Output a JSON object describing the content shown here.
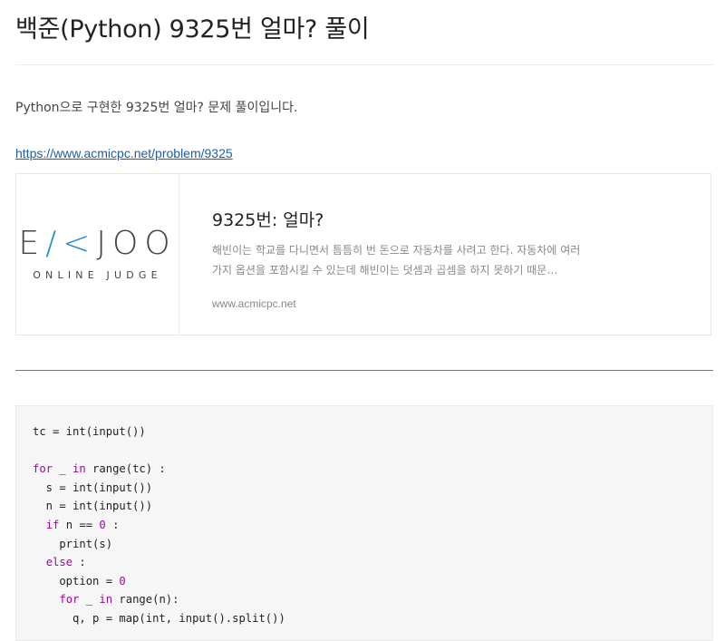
{
  "post": {
    "title": "백준(Python) 9325번 얼마? 풀이",
    "intro": "Python으로 구현한 9325번 얼마? 문제 풀이입니다.",
    "link": "https://www.acmicpc.net/problem/9325"
  },
  "link_card": {
    "logo_main_left": "E",
    "logo_main_accent": "/<",
    "logo_main_right": "JOO",
    "logo_sub": "ONLINE JUDGE",
    "title": "9325번: 얼마?",
    "description": "해빈이는 학교를 다니면서 틈틈히 번 돈으로 자동차를 사려고 한다. 자동차에 여러 가지 옵션을 포함시킬 수 있는데 해빈이는 덧셈과 곱셈을 하지 못하기 때문…",
    "host": "www.acmicpc.net"
  },
  "code": {
    "lines": [
      [
        {
          "t": "tc = int(input())",
          "c": ""
        }
      ],
      [
        {
          "t": "",
          "c": ""
        }
      ],
      [
        {
          "t": "for",
          "c": "kw"
        },
        {
          "t": " _ ",
          "c": ""
        },
        {
          "t": "in",
          "c": "kw"
        },
        {
          "t": " range(tc) :",
          "c": ""
        }
      ],
      [
        {
          "t": "  s = int(input())",
          "c": ""
        }
      ],
      [
        {
          "t": "  n = int(input())",
          "c": ""
        }
      ],
      [
        {
          "t": "  ",
          "c": ""
        },
        {
          "t": "if",
          "c": "kw"
        },
        {
          "t": " n == ",
          "c": ""
        },
        {
          "t": "0",
          "c": "num"
        },
        {
          "t": " :",
          "c": ""
        }
      ],
      [
        {
          "t": "    print(s)",
          "c": ""
        }
      ],
      [
        {
          "t": "  ",
          "c": ""
        },
        {
          "t": "else",
          "c": "kw"
        },
        {
          "t": " :",
          "c": ""
        }
      ],
      [
        {
          "t": "    option = ",
          "c": ""
        },
        {
          "t": "0",
          "c": "num"
        }
      ],
      [
        {
          "t": "    ",
          "c": ""
        },
        {
          "t": "for",
          "c": "kw"
        },
        {
          "t": " _ ",
          "c": ""
        },
        {
          "t": "in",
          "c": "kw"
        },
        {
          "t": " range(n):",
          "c": ""
        }
      ],
      [
        {
          "t": "      q, p = map(int, input().split())",
          "c": ""
        }
      ]
    ]
  }
}
